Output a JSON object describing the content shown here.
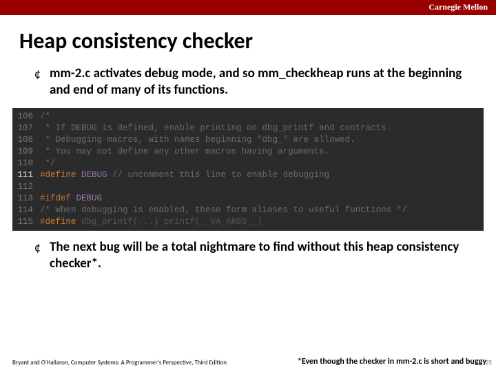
{
  "brand": "Carnegie Mellon",
  "title": "Heap consistency checker",
  "bullets": [
    "mm-2.c activates debug mode, and so mm_checkheap runs at the beginning and end of many of its functions.",
    "The next bug will be a total nightmare to find without this heap consistency checker*."
  ],
  "code": {
    "lines": [
      {
        "num": "106",
        "type": "cmt",
        "text": "/*"
      },
      {
        "num": "107",
        "type": "cmt",
        "text": " * If DEBUG is defined, enable printing on dbg_printf and contracts."
      },
      {
        "num": "108",
        "type": "cmt",
        "text": " * Debugging macros, with names beginning \"dbg_\" are allowed."
      },
      {
        "num": "109",
        "type": "cmt",
        "text": " * You may not define any other macros having arguments."
      },
      {
        "num": "110",
        "type": "cmt",
        "text": " */"
      },
      {
        "num": "111",
        "hl": true,
        "segments": [
          {
            "cls": "pp",
            "t": "#define "
          },
          {
            "cls": "mac",
            "t": "DEBUG "
          },
          {
            "cls": "cmt",
            "t": "// uncomment this line to enable debugging"
          }
        ]
      },
      {
        "num": "112",
        "type": "blank",
        "text": ""
      },
      {
        "num": "113",
        "segments": [
          {
            "cls": "pp",
            "t": "#ifdef "
          },
          {
            "cls": "mac",
            "t": "DEBUG"
          }
        ]
      },
      {
        "num": "114",
        "type": "cmt",
        "text": "/* When debugging is enabled, these form aliases to useful functions */"
      },
      {
        "num": "115",
        "segments": [
          {
            "cls": "pp",
            "t": "#define "
          },
          {
            "cls": "dim",
            "t": "dbg_printf(...) printf(__VA_ARGS__)"
          }
        ]
      }
    ]
  },
  "footer": {
    "left": "Bryant and O'Hallaron, Computer Systems: A Programmer's Perspective, Third Edition",
    "right": "*Even though the checker in mm-2.c is short and buggy",
    "page": "25"
  }
}
